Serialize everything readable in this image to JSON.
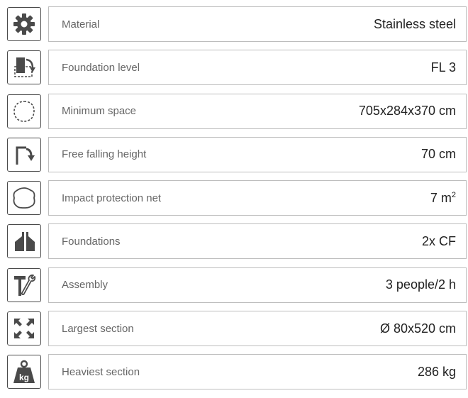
{
  "specs": [
    {
      "icon": "gear-icon",
      "label": "Material",
      "value": "Stainless steel"
    },
    {
      "icon": "foundation-level-icon",
      "label": "Foundation level",
      "value": "FL 3"
    },
    {
      "icon": "minimum-space-icon",
      "label": "Minimum space",
      "value": "705x284x370 cm"
    },
    {
      "icon": "fall-height-icon",
      "label": "Free falling height",
      "value": "70 cm"
    },
    {
      "icon": "impact-net-icon",
      "label": "Impact protection net",
      "value": "7 m",
      "value_sup": "2"
    },
    {
      "icon": "foundations-icon",
      "label": "Foundations",
      "value": "2x CF"
    },
    {
      "icon": "hammer-wrench-icon",
      "label": "Assembly",
      "value": "3 people/2 h"
    },
    {
      "icon": "expand-arrows-icon",
      "label": "Largest section",
      "value": "Ø 80x520 cm"
    },
    {
      "icon": "weight-kg-icon",
      "label": "Heaviest section",
      "value": "286 kg",
      "icon_text": "kg"
    }
  ]
}
